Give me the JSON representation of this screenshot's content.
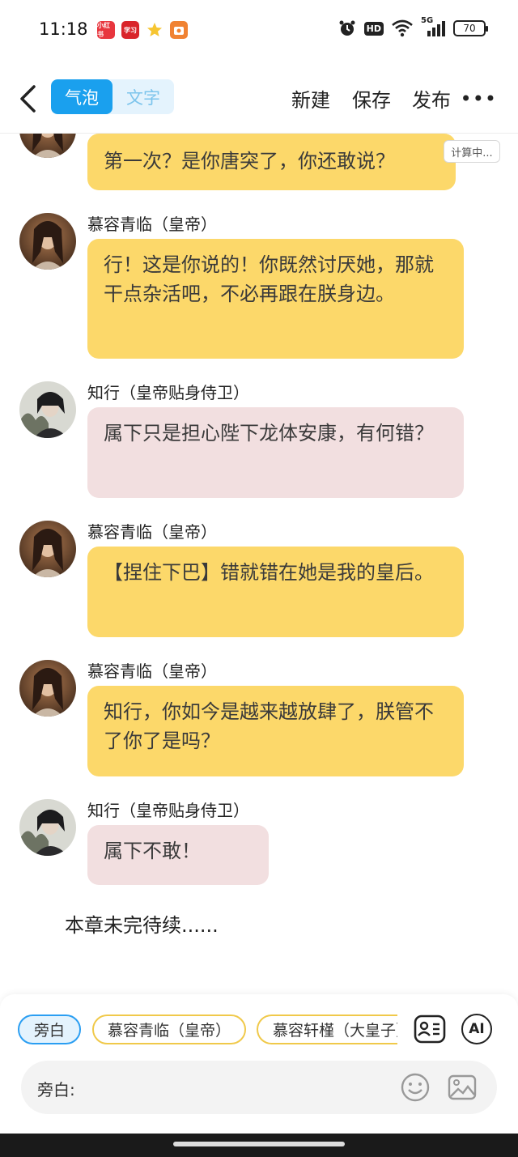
{
  "status_bar": {
    "time": "11:18",
    "app_icons": [
      {
        "name": "xiaohongshu-icon",
        "label": "小红书",
        "color": "#e8363e"
      },
      {
        "name": "study-app-icon",
        "label": "学习",
        "color": "#d9252b"
      },
      {
        "name": "star-app-icon",
        "label": "",
        "color": "#f6c531"
      },
      {
        "name": "shopping-app-icon",
        "label": "",
        "color": "#f08232"
      }
    ],
    "hd_label": "HD",
    "network_label": "5G",
    "battery": "70"
  },
  "toolbar": {
    "mode_bubble": "气泡",
    "mode_text": "文字",
    "new_label": "新建",
    "save_label": "保存",
    "publish_label": "发布",
    "more_label": "•••"
  },
  "chat": {
    "calc_tag": "计算中...",
    "messages": [
      {
        "speaker": "",
        "avatar": "emperor",
        "style": "yellow",
        "text": "第一次？是你唐突了，你还敢说？"
      },
      {
        "speaker": "慕容青临（皇帝）",
        "avatar": "emperor",
        "style": "yellow",
        "text": "行！这是你说的！你既然讨厌她，那就干点杂活吧，不必再跟在朕身边。"
      },
      {
        "speaker": "知行（皇帝贴身侍卫）",
        "avatar": "guard",
        "style": "pink",
        "text": "属下只是担心陛下龙体安康，有何错？"
      },
      {
        "speaker": "慕容青临（皇帝）",
        "avatar": "emperor",
        "style": "yellow",
        "text": "【捏住下巴】错就错在她是我的皇后。"
      },
      {
        "speaker": "慕容青临（皇帝）",
        "avatar": "emperor",
        "style": "yellow",
        "text": "知行，你如今是越来越放肆了，朕管不了你了是吗？"
      },
      {
        "speaker": "知行（皇帝贴身侍卫）",
        "avatar": "guard",
        "style": "pink",
        "text": "属下不敢！"
      }
    ],
    "to_be_continued": "本章未完待续......"
  },
  "bottom": {
    "chips": [
      "旁白",
      "慕容青临（皇帝）",
      "慕容轩槿（大皇子）"
    ],
    "role_card_icon": "role-card-icon",
    "ai_label": "AI",
    "input_label": "旁白:"
  },
  "colors": {
    "accent": "#1aa0ee",
    "bubble_yellow": "#fcd86a",
    "bubble_pink": "#f2dfe0",
    "chip_border_yellow": "#f0c94a"
  }
}
